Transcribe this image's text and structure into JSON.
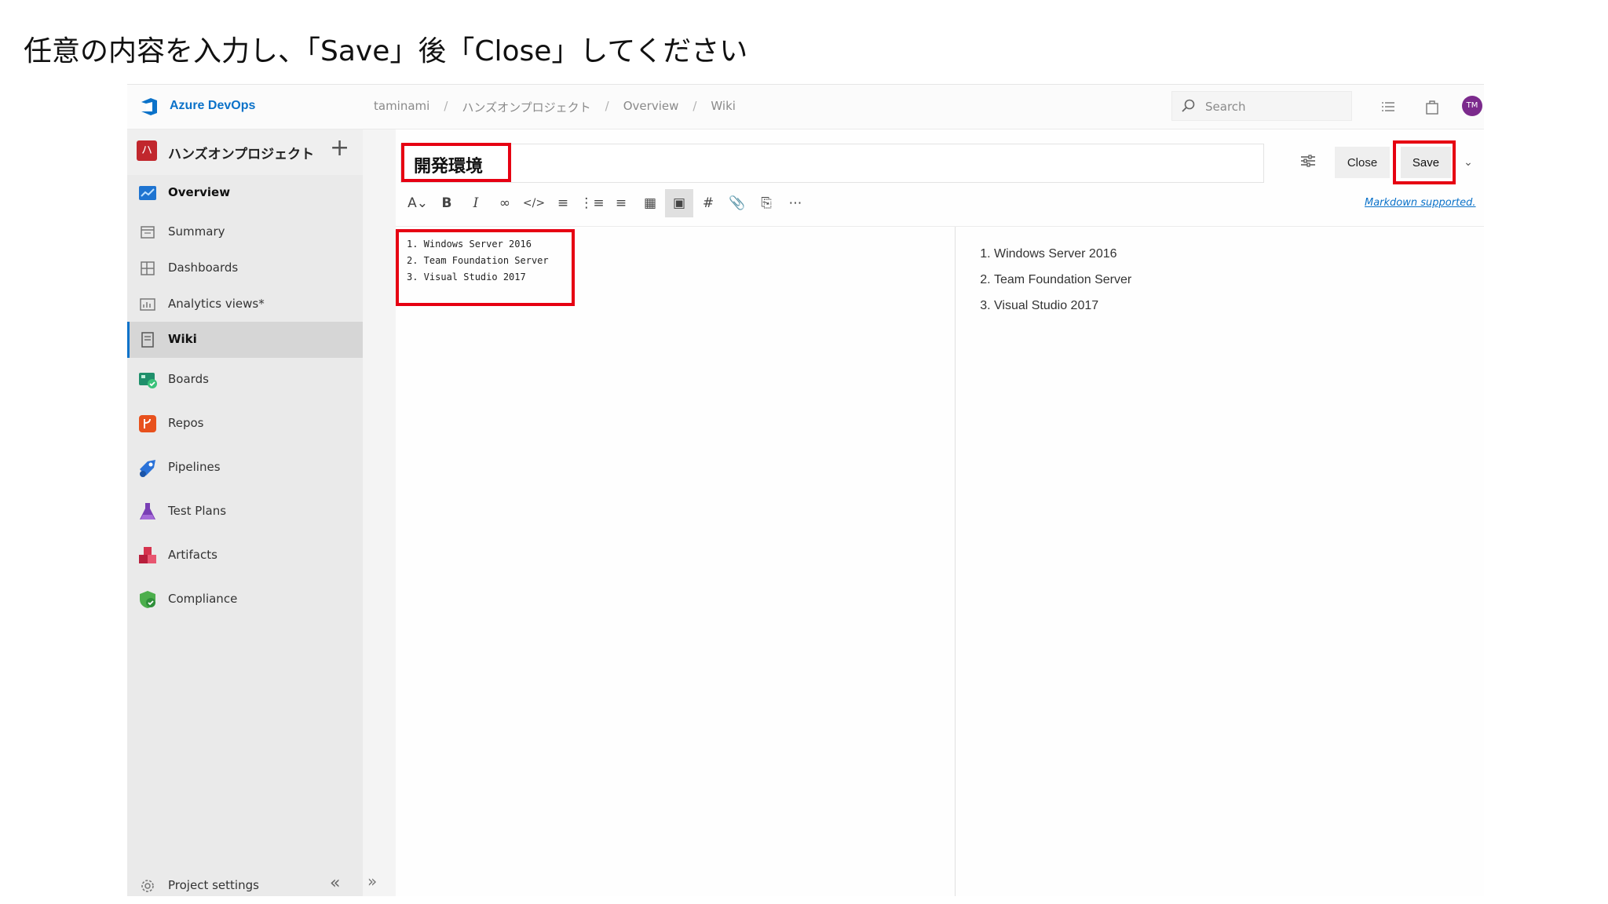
{
  "instruction": "任意の内容を入力し、「Save」後「Close」してください",
  "topbar": {
    "brand": "Azure DevOps",
    "breadcrumb": [
      "taminami",
      "ハンズオンプロジェクト",
      "Overview",
      "Wiki"
    ],
    "breadcrumb_sep": "/",
    "search_placeholder": "Search",
    "avatar_initials": "TM"
  },
  "sidebar": {
    "project_initial": "ハ",
    "project_name": "ハンズオンプロジェクト",
    "add_label": "+",
    "items": [
      {
        "label": "Overview",
        "icon": "overview-icon",
        "bold": true
      },
      {
        "label": "Summary",
        "icon": "summary-icon"
      },
      {
        "label": "Dashboards",
        "icon": "dashboards-icon"
      },
      {
        "label": "Analytics views*",
        "icon": "analytics-icon"
      },
      {
        "label": "Wiki",
        "icon": "wiki-icon",
        "active": true
      },
      {
        "label": "Boards",
        "icon": "boards-icon"
      },
      {
        "label": "Repos",
        "icon": "repos-icon"
      },
      {
        "label": "Pipelines",
        "icon": "pipelines-icon"
      },
      {
        "label": "Test Plans",
        "icon": "test-plans-icon"
      },
      {
        "label": "Artifacts",
        "icon": "artifacts-icon"
      },
      {
        "label": "Compliance",
        "icon": "compliance-icon"
      }
    ],
    "project_settings": "Project settings"
  },
  "editor": {
    "title": "開発環境",
    "close_label": "Close",
    "save_label": "Save",
    "markdown_link": "Markdown supported.",
    "source_lines": [
      "1. Windows Server 2016",
      "2. Team Foundation Server",
      "3. Visual Studio 2017"
    ],
    "preview_items": [
      "Windows Server 2016",
      "Team Foundation Server",
      "Visual Studio 2017"
    ]
  },
  "colors": {
    "accent": "#0b72c9",
    "highlight": "#e60012",
    "project_badge": "#c1272d"
  }
}
